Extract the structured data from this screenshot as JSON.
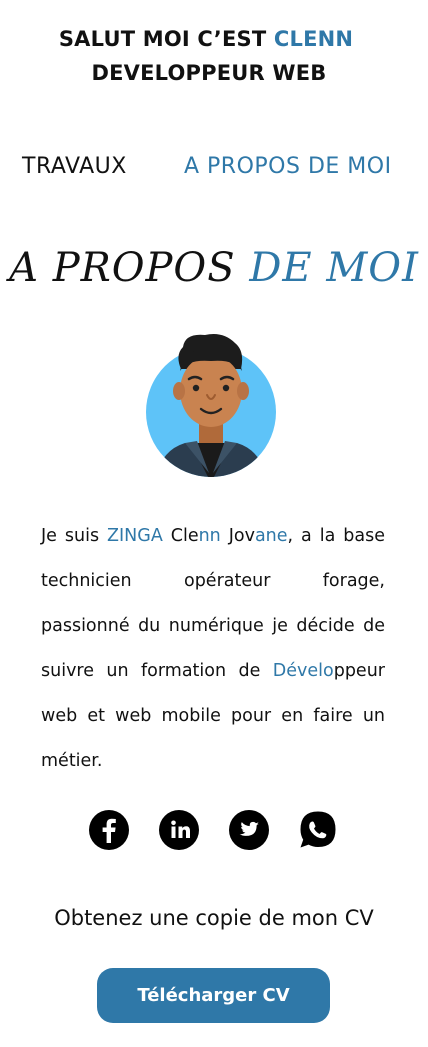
{
  "header": {
    "line1_prefix": "SALUT MOI C’EST ",
    "line1_name": "CLENN",
    "line2": "DEVELOPPEUR WEB"
  },
  "nav": {
    "items": [
      {
        "label": "TRAVAUX"
      },
      {
        "label": "A PROPOS DE MOI"
      }
    ]
  },
  "about": {
    "title_part1": "A PROPOS ",
    "title_part2": "DE MOI",
    "bio": [
      {
        "text": "Je suis ",
        "accent": false
      },
      {
        "text": "ZINGA",
        "accent": true
      },
      {
        "text": " Cle",
        "accent": false
      },
      {
        "text": "nn",
        "accent": true
      },
      {
        "text": " Jov",
        "accent": false
      },
      {
        "text": "ane",
        "accent": true
      },
      {
        "text": ", a la base technicien opérateur forage, passionné du numérique je décide de suivre un formation de ",
        "accent": false
      },
      {
        "text": "Dévelo",
        "accent": true
      },
      {
        "text": "ppeur web et web mobile pour en faire un métier.",
        "accent": false
      }
    ]
  },
  "socials": [
    {
      "icon": "facebook-icon"
    },
    {
      "icon": "linkedin-icon"
    },
    {
      "icon": "twitter-icon"
    },
    {
      "icon": "whatsapp-icon"
    }
  ],
  "cv": {
    "text": "Obtenez une copie de mon CV",
    "button_label": "Télécharger CV"
  },
  "colors": {
    "accent": "#2f78a8",
    "text": "#111111",
    "avatar_bg": "#5ec3f8"
  }
}
